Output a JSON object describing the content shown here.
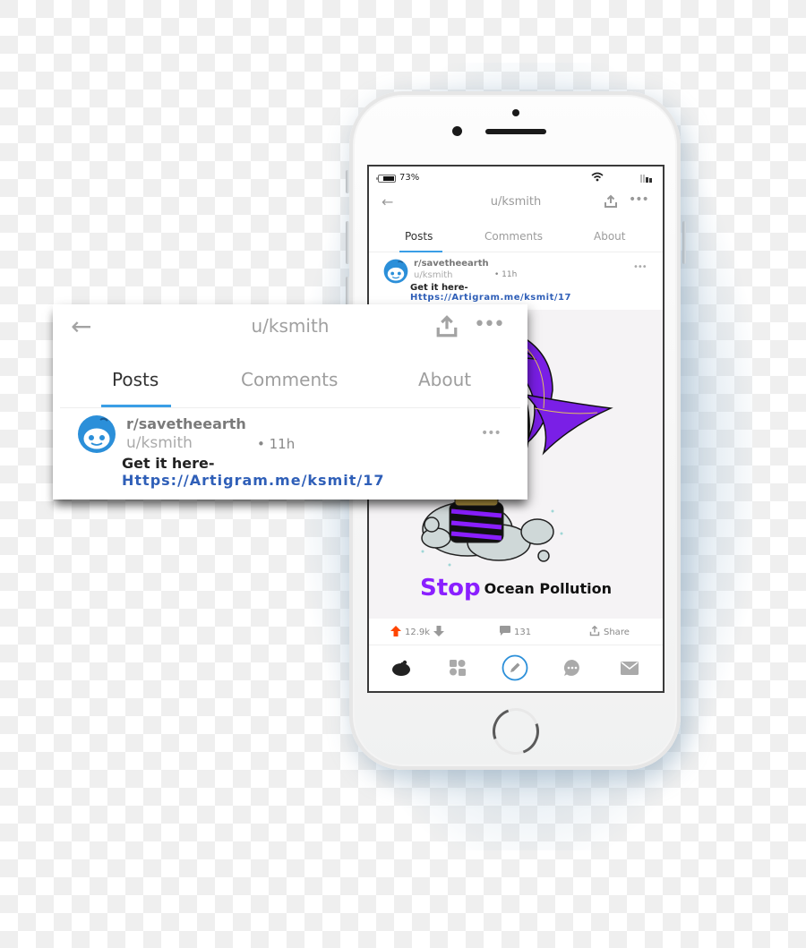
{
  "status_bar": {
    "battery_percent": "73%",
    "battery_level": 0.73,
    "wifi_icon": "wifi-icon",
    "signal_icon": "signal-icon"
  },
  "header": {
    "back_icon": "arrow-left-icon",
    "title": "u/ksmith",
    "share_icon": "share-upload-icon",
    "more_icon": "more-horizontal-icon"
  },
  "tabs": [
    {
      "label": "Posts",
      "active": true
    },
    {
      "label": "Comments",
      "active": false
    },
    {
      "label": "About",
      "active": false
    }
  ],
  "post": {
    "subreddit": "r/savetheearth",
    "author": "u/ksmith",
    "age": "• 11h",
    "body": "Get it here-",
    "link": "Https://Artigram.me/ksmit/17",
    "image_caption_highlight": "Stop",
    "image_caption_rest": "Ocean Pollution",
    "upvotes": "12.9k",
    "comments": "131",
    "share_label": "Share"
  },
  "bottom_nav": [
    {
      "icon": "home-reddit-icon",
      "active": true
    },
    {
      "icon": "communities-grid-icon",
      "active": false
    },
    {
      "icon": "create-post-pencil-icon",
      "active": false
    },
    {
      "icon": "chat-icon",
      "active": false
    },
    {
      "icon": "inbox-mail-icon",
      "active": false
    }
  ],
  "colors": {
    "accent_blue": "#3a9ee6",
    "link_blue": "#2f5fb8",
    "upvote_orange": "#ff4500",
    "caption_purple": "#8a1fff"
  }
}
